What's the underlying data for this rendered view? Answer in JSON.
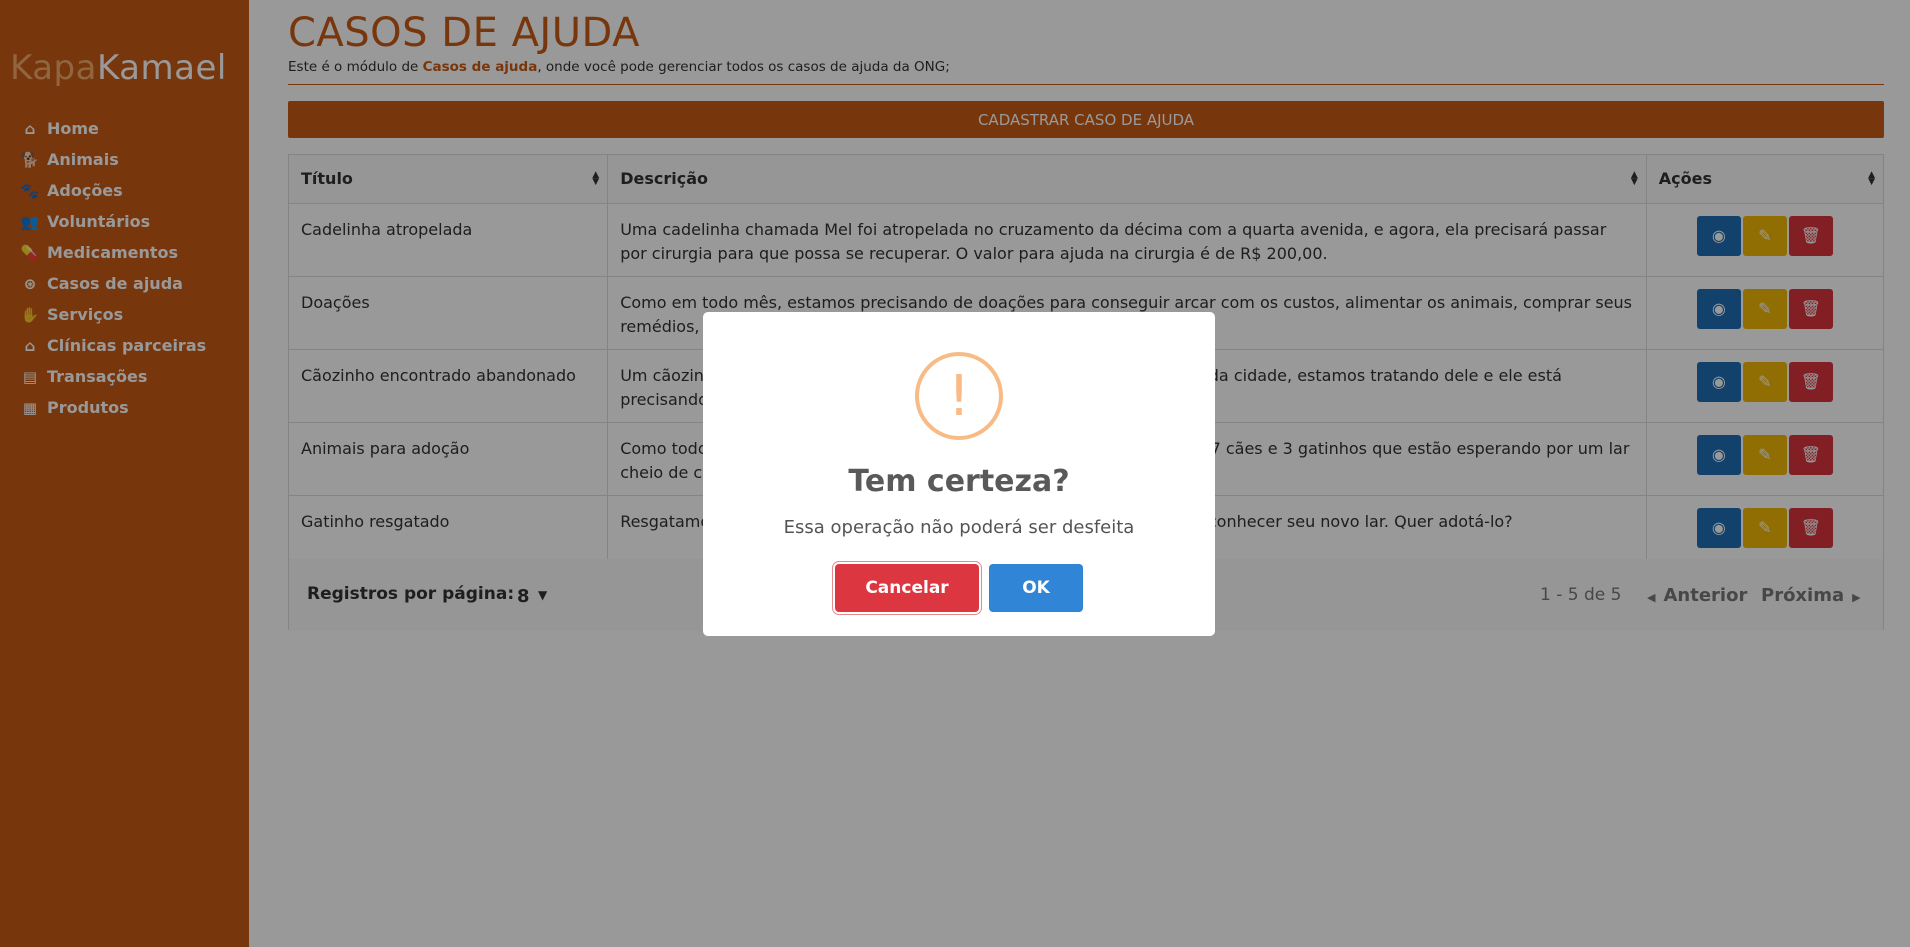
{
  "brand": {
    "part1": "Kapa",
    "part2": "Kamael"
  },
  "sidebar": {
    "items": [
      {
        "label": "Home",
        "icon": "home-icon",
        "glyph": "⌂"
      },
      {
        "label": "Animais",
        "icon": "dog-icon",
        "glyph": "🐕"
      },
      {
        "label": "Adoções",
        "icon": "paw-icon",
        "glyph": "🐾"
      },
      {
        "label": "Voluntários",
        "icon": "people-icon",
        "glyph": "👥"
      },
      {
        "label": "Medicamentos",
        "icon": "pills-icon",
        "glyph": "💊"
      },
      {
        "label": "Casos de ajuda",
        "icon": "lifebuoy-icon",
        "glyph": "⊛"
      },
      {
        "label": "Serviços",
        "icon": "hand-holding-icon",
        "glyph": "✋"
      },
      {
        "label": "Clínicas parceiras",
        "icon": "clinic-icon",
        "glyph": "⌂"
      },
      {
        "label": "Transações",
        "icon": "money-icon",
        "glyph": "▤"
      },
      {
        "label": "Produtos",
        "icon": "boxes-icon",
        "glyph": "▦"
      }
    ]
  },
  "page": {
    "title": "CASOS DE AJUDA",
    "subtitle_pre": "Este é o módulo de ",
    "subtitle_bold": "Casos de ajuda",
    "subtitle_post": ", onde você pode gerenciar todos os casos de ajuda da ONG;",
    "add_button": "CADASTRAR CASO DE AJUDA"
  },
  "table": {
    "headers": [
      "Título",
      "Descrição",
      "Ações"
    ],
    "rows": [
      {
        "title": "Cadelinha atropelada",
        "description": "Uma cadelinha chamada Mel foi atropelada no cruzamento da décima com a quarta avenida, e agora, ela precisará passar por cirurgia para que possa se recuperar. O valor para ajuda na cirurgia é de R$ 200,00."
      },
      {
        "title": "Doações",
        "description": "Como em todo mês, estamos precisando de doações para conseguir arcar com os custos, alimentar os animais, comprar seus remédios, e cuidar de cada um deles."
      },
      {
        "title": "Cãozinho encontrado abandonado",
        "description": "Um cãozinho foi encontrado abandonado em uma rua próximo ao centro da cidade, estamos tratando dele e ele está precisando de um lar. Ele é dócil e aparenta ter 2 anos de idade."
      },
      {
        "title": "Animais para adoção",
        "description": "Como todos os meses, temos animais esperando por um novo lar. Temos 7 cães e 3 gatinhos que estão esperando por um lar cheio de carinho."
      },
      {
        "title": "Gatinho resgatado",
        "description": "Resgatamos um gatinho que estava na rua, e agora ele está ansioso por conhecer seu novo lar. Quer adotá-lo?"
      }
    ],
    "footer": {
      "rows_per_page_label": "Registros por página:",
      "rows_per_page_value": "8",
      "range": "1 - 5 de 5",
      "prev": "Anterior",
      "next": "Próxima"
    }
  },
  "modal": {
    "icon": "!",
    "title": "Tem certeza?",
    "text": "Essa operação não poderá ser desfeita",
    "cancel": "Cancelar",
    "ok": "OK"
  },
  "colors": {
    "brand": "#c85a14",
    "view": "#1e6fb5",
    "edit": "#f2b705",
    "delete": "#d9343f",
    "ok": "#3085d6",
    "cancel": "#dc3741",
    "warning": "#f8bb86"
  }
}
